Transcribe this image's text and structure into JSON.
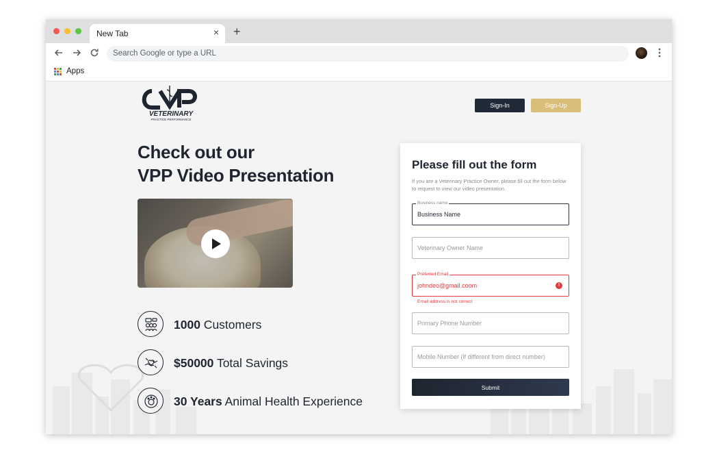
{
  "browser": {
    "tab_title": "New Tab",
    "tab_close": "×",
    "new_tab": "+",
    "address_placeholder": "Search Google or type a URL",
    "bookmark_apps": "Apps"
  },
  "header": {
    "logo_text": "VETERINARY",
    "logo_subtext": "PRACTICE PERFORMANCE",
    "signin_label": "Sign-In",
    "signup_label": "Sign-Up"
  },
  "hero": {
    "headline_line1": "Check out our",
    "headline_line2": "VPP Video Presentation"
  },
  "stats": [
    {
      "value": "1000",
      "label": " Customers",
      "icon": "customers-icon"
    },
    {
      "value": "$50000",
      "label": " Total Savings",
      "icon": "savings-icon"
    },
    {
      "value": "30 Years",
      "label": " Animal Health Experience",
      "icon": "animal-health-icon"
    }
  ],
  "form": {
    "title": "Please fill out the form",
    "description": "If you are a Veterinary Practice Owner, please fill out the form below to request to view our video presentation.",
    "business_name": {
      "label": "Business name",
      "value": "Business Name"
    },
    "owner_name": {
      "placeholder": "Veterinary Owner Name"
    },
    "email": {
      "label": "Preferred Email",
      "value": "johndeo@gmail.coom",
      "error": "Email address is not correct"
    },
    "phone": {
      "placeholder": "Primary Phone Number"
    },
    "mobile": {
      "placeholder": "Mobile Number (if different from direct number)"
    },
    "submit_label": "Submit"
  },
  "colors": {
    "navy": "#1f2a36",
    "gold": "#d9be7a",
    "error": "#e0393e"
  }
}
